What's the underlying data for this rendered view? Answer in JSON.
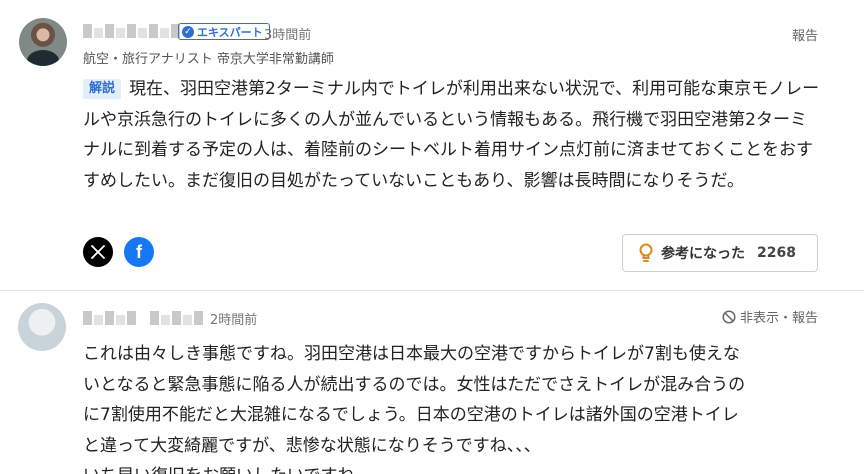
{
  "comments": [
    {
      "badge": "エキスパート",
      "time": "3時間前",
      "title": "航空・旅行アナリスト 帝京大学非常勤講師",
      "report": "報告",
      "tag": "解説",
      "text": "現在、羽田空港第2ターミナル内でトイレが利用出来ない状況で、利用可能な東京モノレールや京浜急行のトイレに多くの人が並んでいるという情報もある。飛行機で羽田空港第2ターミナルに到着する予定の人は、着陸前のシートベルト着用サイン点灯前に済ませておくことをおすすめしたい。まだ復旧の目処がたっていないこともあり、影響は長時間になりそうだ。",
      "helpful_label": "参考になった",
      "helpful_count": "2268",
      "icons": [
        "x-logo-icon",
        "facebook-icon",
        "lightbulb-icon",
        "verified-check-icon"
      ]
    },
    {
      "time": "2時間前",
      "hide_report": "非表示・報告",
      "text_lines": [
        "これは由々しき事態ですね。羽田空港は日本最大の空港ですからトイレが7割も使えな",
        "いとなると緊急事態に陥る人が続出するのでは。女性はただでさえトイレが混み合うの",
        "に7割使用不能だと大混雑になるでしょう。日本の空港のトイレは諸外国の空港トイレ",
        "と違って大変綺麗ですが、悲惨な状態になりそうですね、、、",
        "いち早い復旧をお願いしたいですね。"
      ],
      "icons": [
        "block-icon"
      ]
    }
  ]
}
